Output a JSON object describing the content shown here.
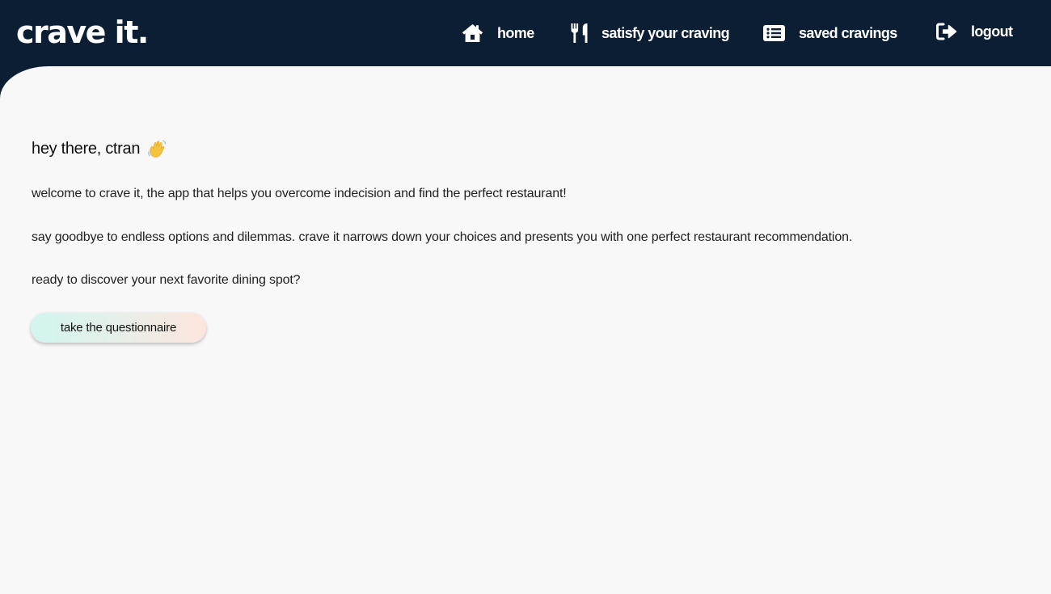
{
  "app": {
    "logo": "crave it."
  },
  "nav": {
    "items": [
      {
        "label": "home",
        "icon": "home-icon"
      },
      {
        "label": "satisfy your craving",
        "icon": "utensils-icon"
      },
      {
        "label": "saved cravings",
        "icon": "list-icon"
      },
      {
        "label": "logout",
        "icon": "sign-out-icon"
      }
    ]
  },
  "main": {
    "greeting": "hey there, ctran",
    "greeting_icon": "waving-hand-icon",
    "paragraphs": [
      "welcome to crave it, the app that helps you overcome indecision and find the perfect restaurant!",
      "say goodbye to endless options and dilemmas. crave it narrows down your choices and presents you with one perfect restaurant recommendation.",
      "ready to discover your next favorite dining spot?"
    ],
    "cta_label": "take the questionnaire"
  },
  "colors": {
    "navbar": "#0b1e33",
    "content_bg": "#f8f8f8",
    "text": "#222222",
    "button_gradient_start": "#d2f5ef",
    "button_gradient_end": "#fde5dc"
  }
}
